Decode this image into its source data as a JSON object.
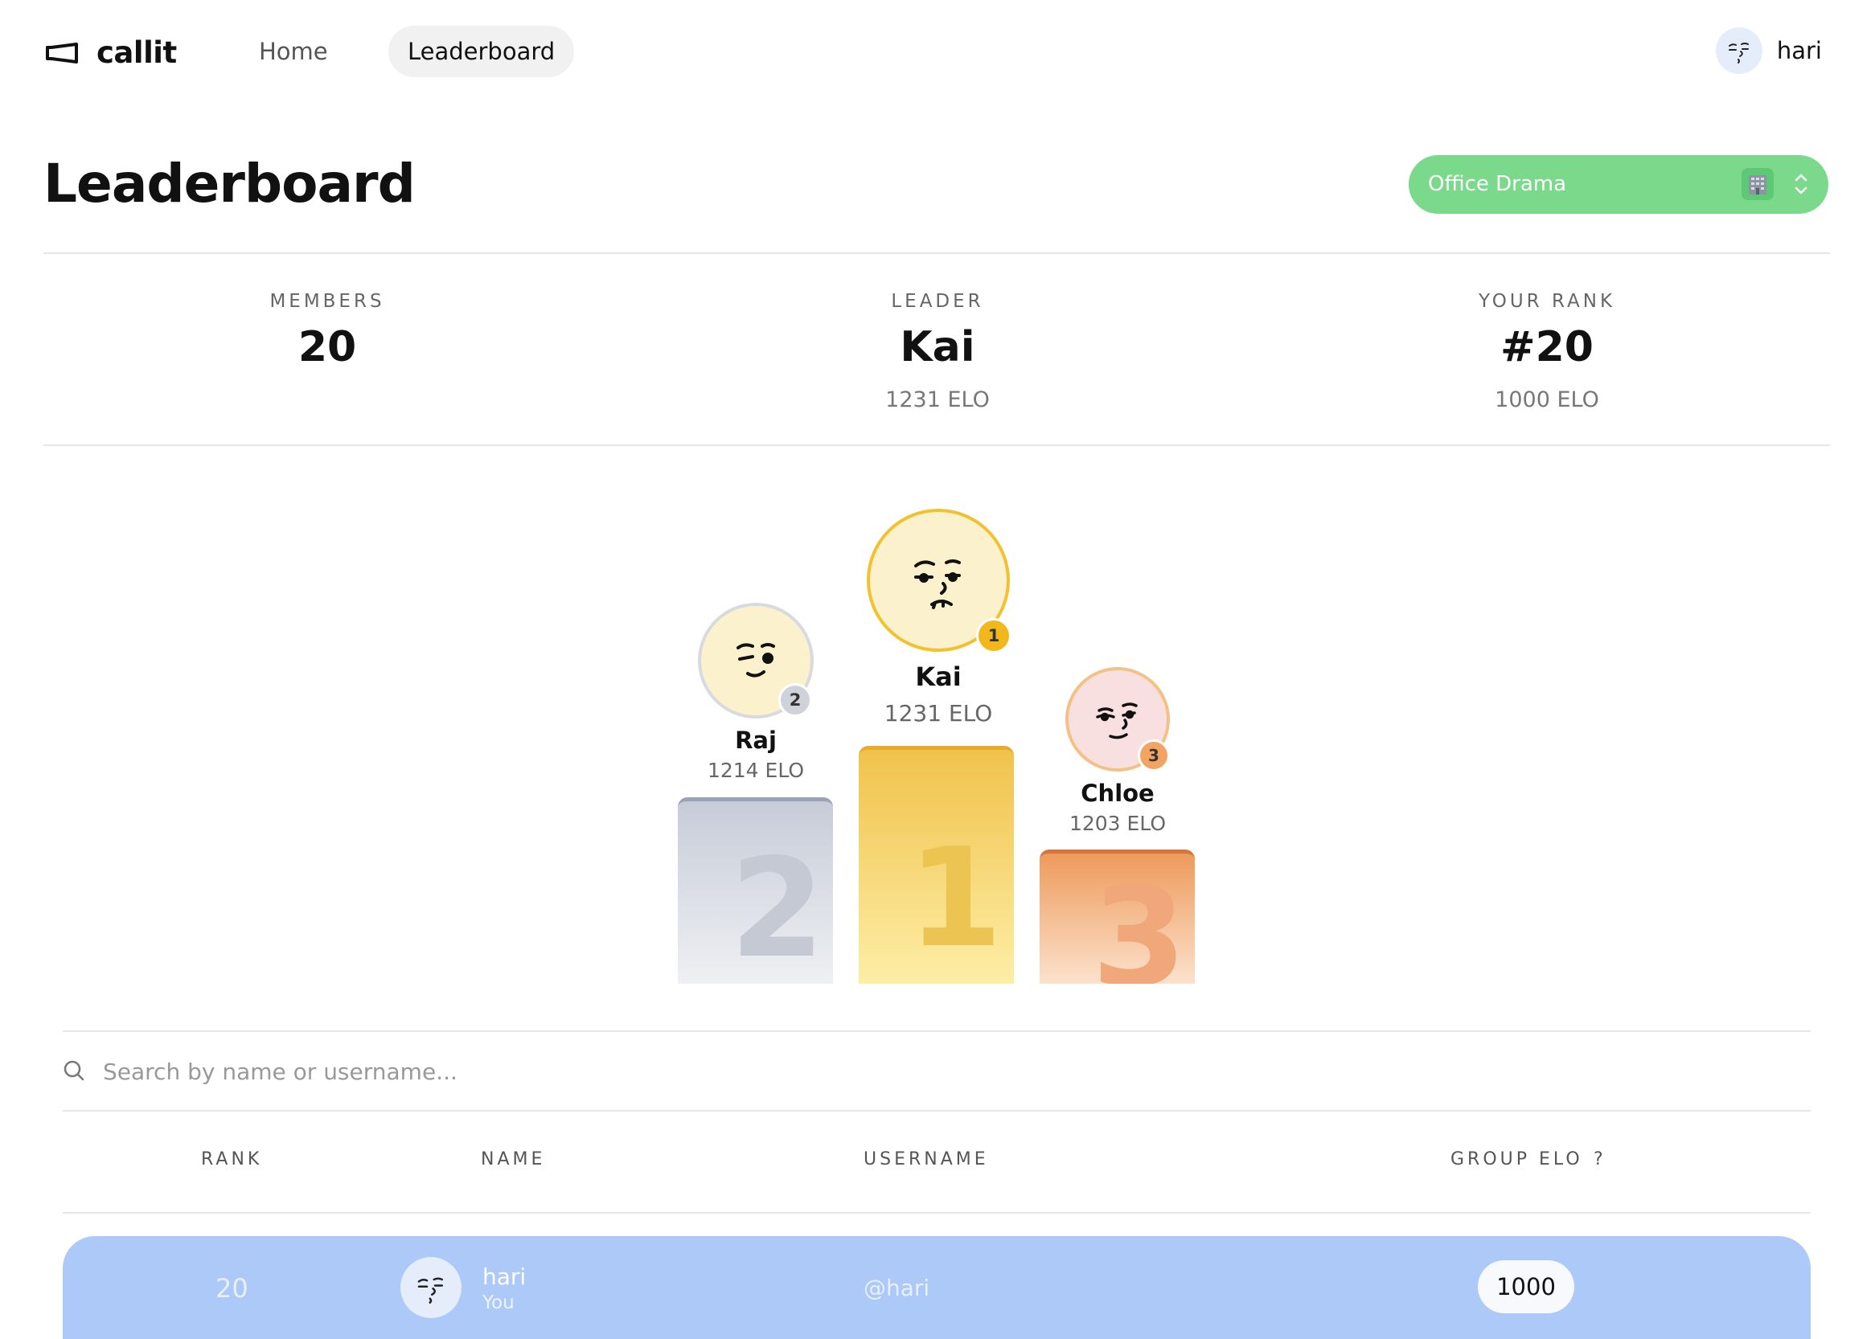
{
  "nav": {
    "brand": "callit",
    "home": "Home",
    "leaderboard": "Leaderboard",
    "user": "hari"
  },
  "header": {
    "title": "Leaderboard",
    "group": "Office Drama",
    "group_icon": "office-building-icon"
  },
  "stats": {
    "members_label": "MEMBERS",
    "members_value": "20",
    "leader_label": "LEADER",
    "leader_value": "Kai",
    "leader_sub": "1231 ELO",
    "rank_label": "YOUR RANK",
    "rank_value": "#20",
    "rank_sub": "1000 ELO"
  },
  "podium": {
    "first": {
      "rank": "1",
      "name": "Kai",
      "elo": "1231 ELO"
    },
    "second": {
      "rank": "2",
      "name": "Raj",
      "elo": "1214 ELO"
    },
    "third": {
      "rank": "3",
      "name": "Chloe",
      "elo": "1203 ELO"
    }
  },
  "search": {
    "placeholder": "Search by name or username..."
  },
  "table": {
    "headers": {
      "rank": "RANK",
      "name": "NAME",
      "username": "USERNAME",
      "elo": "GROUP ELO",
      "help": "?"
    },
    "rows": [
      {
        "rank": "20",
        "name": "hari",
        "you": "You",
        "username": "@hari",
        "elo": "1000"
      }
    ]
  },
  "colors": {
    "accent_group": "#7ad98a",
    "gold": "#f0c24b",
    "silver": "#c9ced9",
    "bronze": "#ee9a5c",
    "current_row": "#adc9f7"
  }
}
